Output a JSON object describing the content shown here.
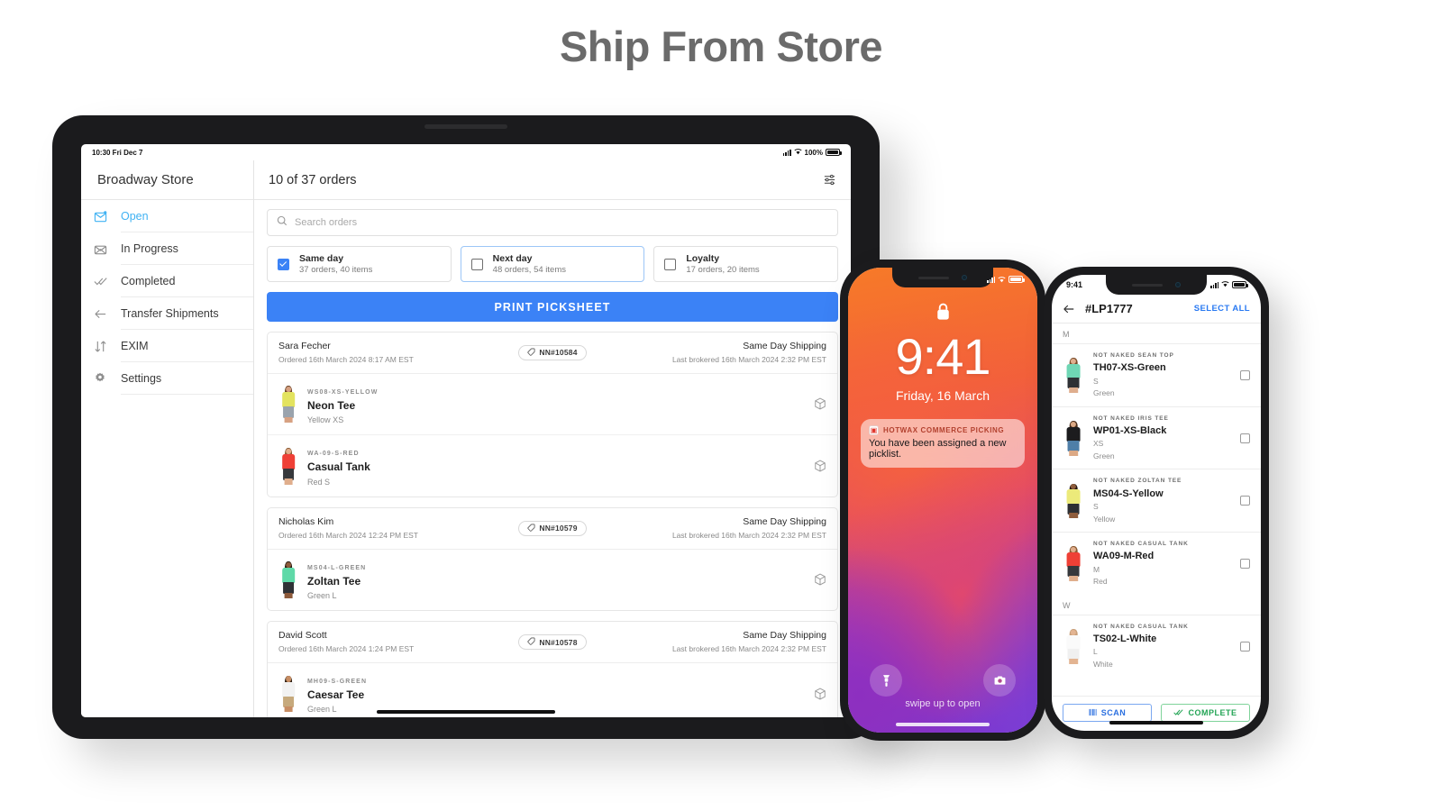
{
  "page": {
    "title": "Ship From Store"
  },
  "tablet": {
    "status_bar": {
      "time_date": "10:30 Fri Dec 7",
      "battery": "100%"
    },
    "sidebar": {
      "store_name": "Broadway Store",
      "items": [
        {
          "label": "Open",
          "icon": "inbox-new-icon",
          "active": true
        },
        {
          "label": "In Progress",
          "icon": "envelope-open-icon",
          "active": false
        },
        {
          "label": "Completed",
          "icon": "double-check-icon",
          "active": false
        },
        {
          "label": "Transfer Shipments",
          "icon": "arrow-left-icon",
          "active": false
        },
        {
          "label": "EXIM",
          "icon": "arrows-updown-icon",
          "active": false
        },
        {
          "label": "Settings",
          "icon": "gear-icon",
          "active": false
        }
      ]
    },
    "header": {
      "order_count": "10 of 37 orders",
      "filter_icon": "sliders-icon"
    },
    "search": {
      "placeholder": "Search orders",
      "icon": "search-icon"
    },
    "filters": [
      {
        "title": "Same day",
        "sub": "37 orders, 40 items",
        "checked": true,
        "focused": false
      },
      {
        "title": "Next day",
        "sub": "48 orders, 54 items",
        "checked": false,
        "focused": true
      },
      {
        "title": "Loyalty",
        "sub": "17 orders, 20 items",
        "checked": false,
        "focused": false
      }
    ],
    "print_button": "PRINT PICKSHEET",
    "orders": [
      {
        "customer": "Sara Fecher",
        "ordered": "Ordered 16th March 2024 8:17 AM EST",
        "tag": "NN#10584",
        "shipping": "Same Day Shipping",
        "brokered": "Last brokered 16th March 2024 2:32 PM EST",
        "items": [
          {
            "sku": "WS08-XS-YELLOW",
            "name": "Neon Tee",
            "variant": "Yellow XS",
            "icon": "package-icon",
            "colors": {
              "skin": "#d7a182",
              "hair": "#6b4326",
              "top": "#e3e35f",
              "bottom": "#9aa3ad"
            }
          },
          {
            "sku": "WA-09-S-RED",
            "name": "Casual Tank",
            "variant": "Red S",
            "icon": "package-icon",
            "colors": {
              "skin": "#e0ae8c",
              "hair": "#8a5a33",
              "top": "#ef4036",
              "bottom": "#36383c"
            }
          }
        ]
      },
      {
        "customer": "Nicholas Kim",
        "ordered": "Ordered 16th March 2024 12:24 PM EST",
        "tag": "NN#10579",
        "shipping": "Same Day Shipping",
        "brokered": "Last brokered 16th March 2024 2:32 PM EST",
        "items": [
          {
            "sku": "MS04-L-GREEN",
            "name": "Zoltan Tee",
            "variant": "Green L",
            "icon": "package-icon",
            "colors": {
              "skin": "#8d5a3b",
              "hair": "#23180f",
              "top": "#5fd9a8",
              "bottom": "#2f3136"
            }
          }
        ]
      },
      {
        "customer": "David Scott",
        "ordered": "Ordered 16th March 2024 1:24 PM EST",
        "tag": "NN#10578",
        "shipping": "Same Day Shipping",
        "brokered": "Last brokered 16th March 2024 2:32 PM EST",
        "items": [
          {
            "sku": "MH09-S-GREEN",
            "name": "Caesar Tee",
            "variant": "Green L",
            "icon": "package-icon",
            "colors": {
              "skin": "#c78d63",
              "hair": "#2a1c10",
              "top": "#f2f2f2",
              "bottom": "#c6a97c"
            }
          }
        ]
      }
    ]
  },
  "phone_lock": {
    "status_bar": {
      "battery": ""
    },
    "lock_icon": "lock-icon",
    "time": "9:41",
    "date": "Friday, 16 March",
    "notification": {
      "app_icon": "hotwax-app-icon",
      "app_name": "HOTWAX COMMERCE PICKING",
      "body": "You have been assigned a new picklist."
    },
    "swipe_hint": "swipe up to open",
    "torch_icon": "flashlight-icon",
    "camera_icon": "camera-icon"
  },
  "phone_app": {
    "status_bar": {
      "time": "9:41"
    },
    "header": {
      "back_icon": "arrow-left-icon",
      "title": "#LP1777",
      "select_all": "SELECT ALL"
    },
    "groups": [
      {
        "label": "M",
        "items": [
          {
            "brand": "NOT NAKED SEAN TOP",
            "sku": "TH07-XS-Green",
            "size": "S",
            "color": "Green",
            "checked": false,
            "colors": {
              "skin": "#dfae8e",
              "hair": "#7a4c2a",
              "top": "#6fd6b4",
              "bottom": "#2e3034"
            }
          },
          {
            "brand": "NOT NAKED IRIS TEE",
            "sku": "WP01-XS-Black",
            "size": "XS",
            "color": "Green",
            "checked": false,
            "colors": {
              "skin": "#dca985",
              "hair": "#4a2d1a",
              "top": "#1c1c1e",
              "bottom": "#4f7fa8"
            }
          },
          {
            "brand": "NOT NAKED ZOLTAN TEE",
            "sku": "MS04-S-Yellow",
            "size": "S",
            "color": "Yellow",
            "checked": false,
            "colors": {
              "skin": "#8e5c3c",
              "hair": "#241710",
              "top": "#ecea7a",
              "bottom": "#2d2f33"
            }
          },
          {
            "brand": "NOT NAKED CASUAL TANK",
            "sku": "WA09-M-Red",
            "size": "M",
            "color": "Red",
            "checked": false,
            "colors": {
              "skin": "#e0ae8c",
              "hair": "#8a5a33",
              "top": "#ef4036",
              "bottom": "#36383c"
            }
          }
        ]
      },
      {
        "label": "W",
        "items": [
          {
            "brand": "NOT NAKED CASUAL TANK",
            "sku": "TS02-L-White",
            "size": "L",
            "color": "White",
            "checked": false,
            "colors": {
              "skin": "#e3b492",
              "hair": "#c9a07a",
              "top": "#fafafa",
              "bottom": "#f0f0f0"
            }
          }
        ]
      }
    ],
    "footer": {
      "scan_label": "SCAN",
      "scan_icon": "barcode-icon",
      "complete_label": "COMPLETE",
      "complete_icon": "double-check-icon"
    }
  },
  "colors": {
    "accent_blue": "#3b82f6",
    "link_blue": "#2979f2",
    "active_cyan": "#40b2f3",
    "green": "#23a455",
    "notification_red": "#b2402e"
  }
}
